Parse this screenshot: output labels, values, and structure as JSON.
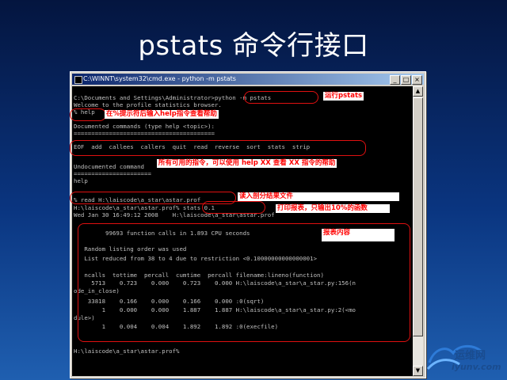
{
  "slide": {
    "title": "pstats 命令行接口"
  },
  "window": {
    "title": "C:\\WINNT\\system32\\cmd.exe - python -m pstats",
    "buttons": {
      "minimize": "_",
      "maximize": "□",
      "close": "×"
    }
  },
  "console": {
    "lines": [
      "C:\\Documents and Settings\\Administrator>python -m pstats",
      "Welcome to the profile statistics browser.",
      "% help",
      "",
      "Documented commands (type help <topic>):",
      "========================================",
      "EOF  add  callees  callers  quit  read  reverse  sort  stats  strip",
      "",
      "Undocumented command",
      "======================",
      "help",
      "",
      "% read H:\\laiscode\\a_star\\astar.prof",
      "H:\\laiscode\\a_star\\astar.prof% stats 0.1",
      "Wed Jan 30 16:49:12 2008    H:\\laiscode\\a_star\\astar.prof",
      "",
      "         99693 function calls in 1.893 CPU seconds",
      "",
      "   Random listing order was used",
      "   List reduced from 38 to 4 due to restriction <0.10000000000000001>",
      "",
      "   ncalls  tottime  percall  cumtime  percall filename:lineno(function)",
      "     5713    0.723    0.000    0.723    0.000 H:\\laiscode\\a_star\\a_star.py:156(n",
      "ode_in_close)",
      "    33818    0.166    0.000    0.166    0.000 :0(sqrt)",
      "        1    0.000    0.000    1.887    1.887 H:\\laiscode\\a_star\\a_star.py:2(<mo",
      "dule>)",
      "        1    0.004    0.004    1.892    1.892 :0(execfile)",
      "",
      "",
      "H:\\laiscode\\a_star\\astar.prof%"
    ]
  },
  "annotations": {
    "run_pstats": "运行pstats",
    "help_hint": "在%提示符后输入help指令查看帮助",
    "commands_hint": "所有可用的指令，可以使用  help XX  查看  XX  指令的帮助",
    "read_hint": "读入剖分结果文件",
    "stats_hint": "打印报表，只输出10%的函数",
    "report_hint": "报表内容"
  },
  "logo": {
    "top": "运维网",
    "bottom": "iyunv.com"
  }
}
